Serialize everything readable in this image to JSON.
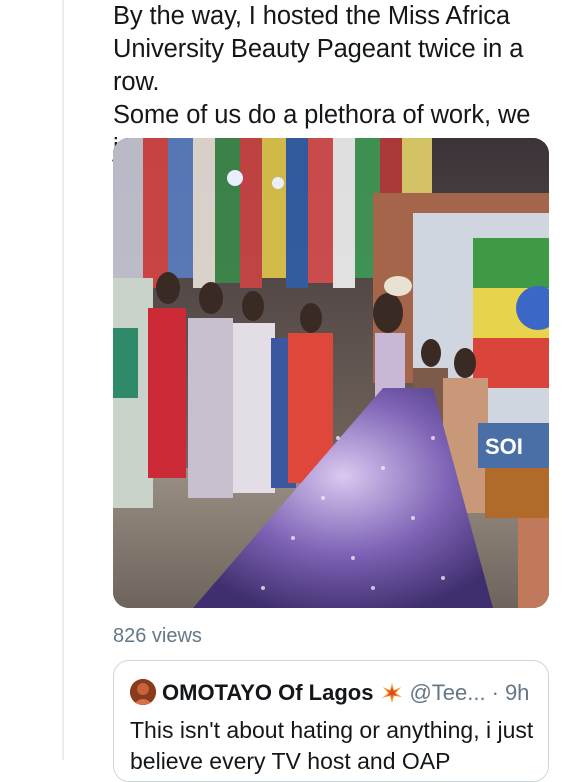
{
  "tweet": {
    "text": "By the way, I hosted the Miss Africa\nUniversity Beauty Pageant twice in a row.\nSome of us do a plethora of work, we just\ndon't like posting.",
    "media": {
      "icon": "video-still",
      "overlay_text": "SOI"
    },
    "views": "826 views"
  },
  "quote": {
    "author_name": "OMOTAYO Of Lagos",
    "author_emoji": "collision-emoji",
    "handle": "@Tee...",
    "separator": "·",
    "time": "9h",
    "text": "This isn't about hating or anything, i just believe every TV host and OAP"
  },
  "colors": {
    "text": "#14171a",
    "secondary": "#657786",
    "border": "#ccd6dd",
    "thread_line": "#e6ecf0"
  }
}
